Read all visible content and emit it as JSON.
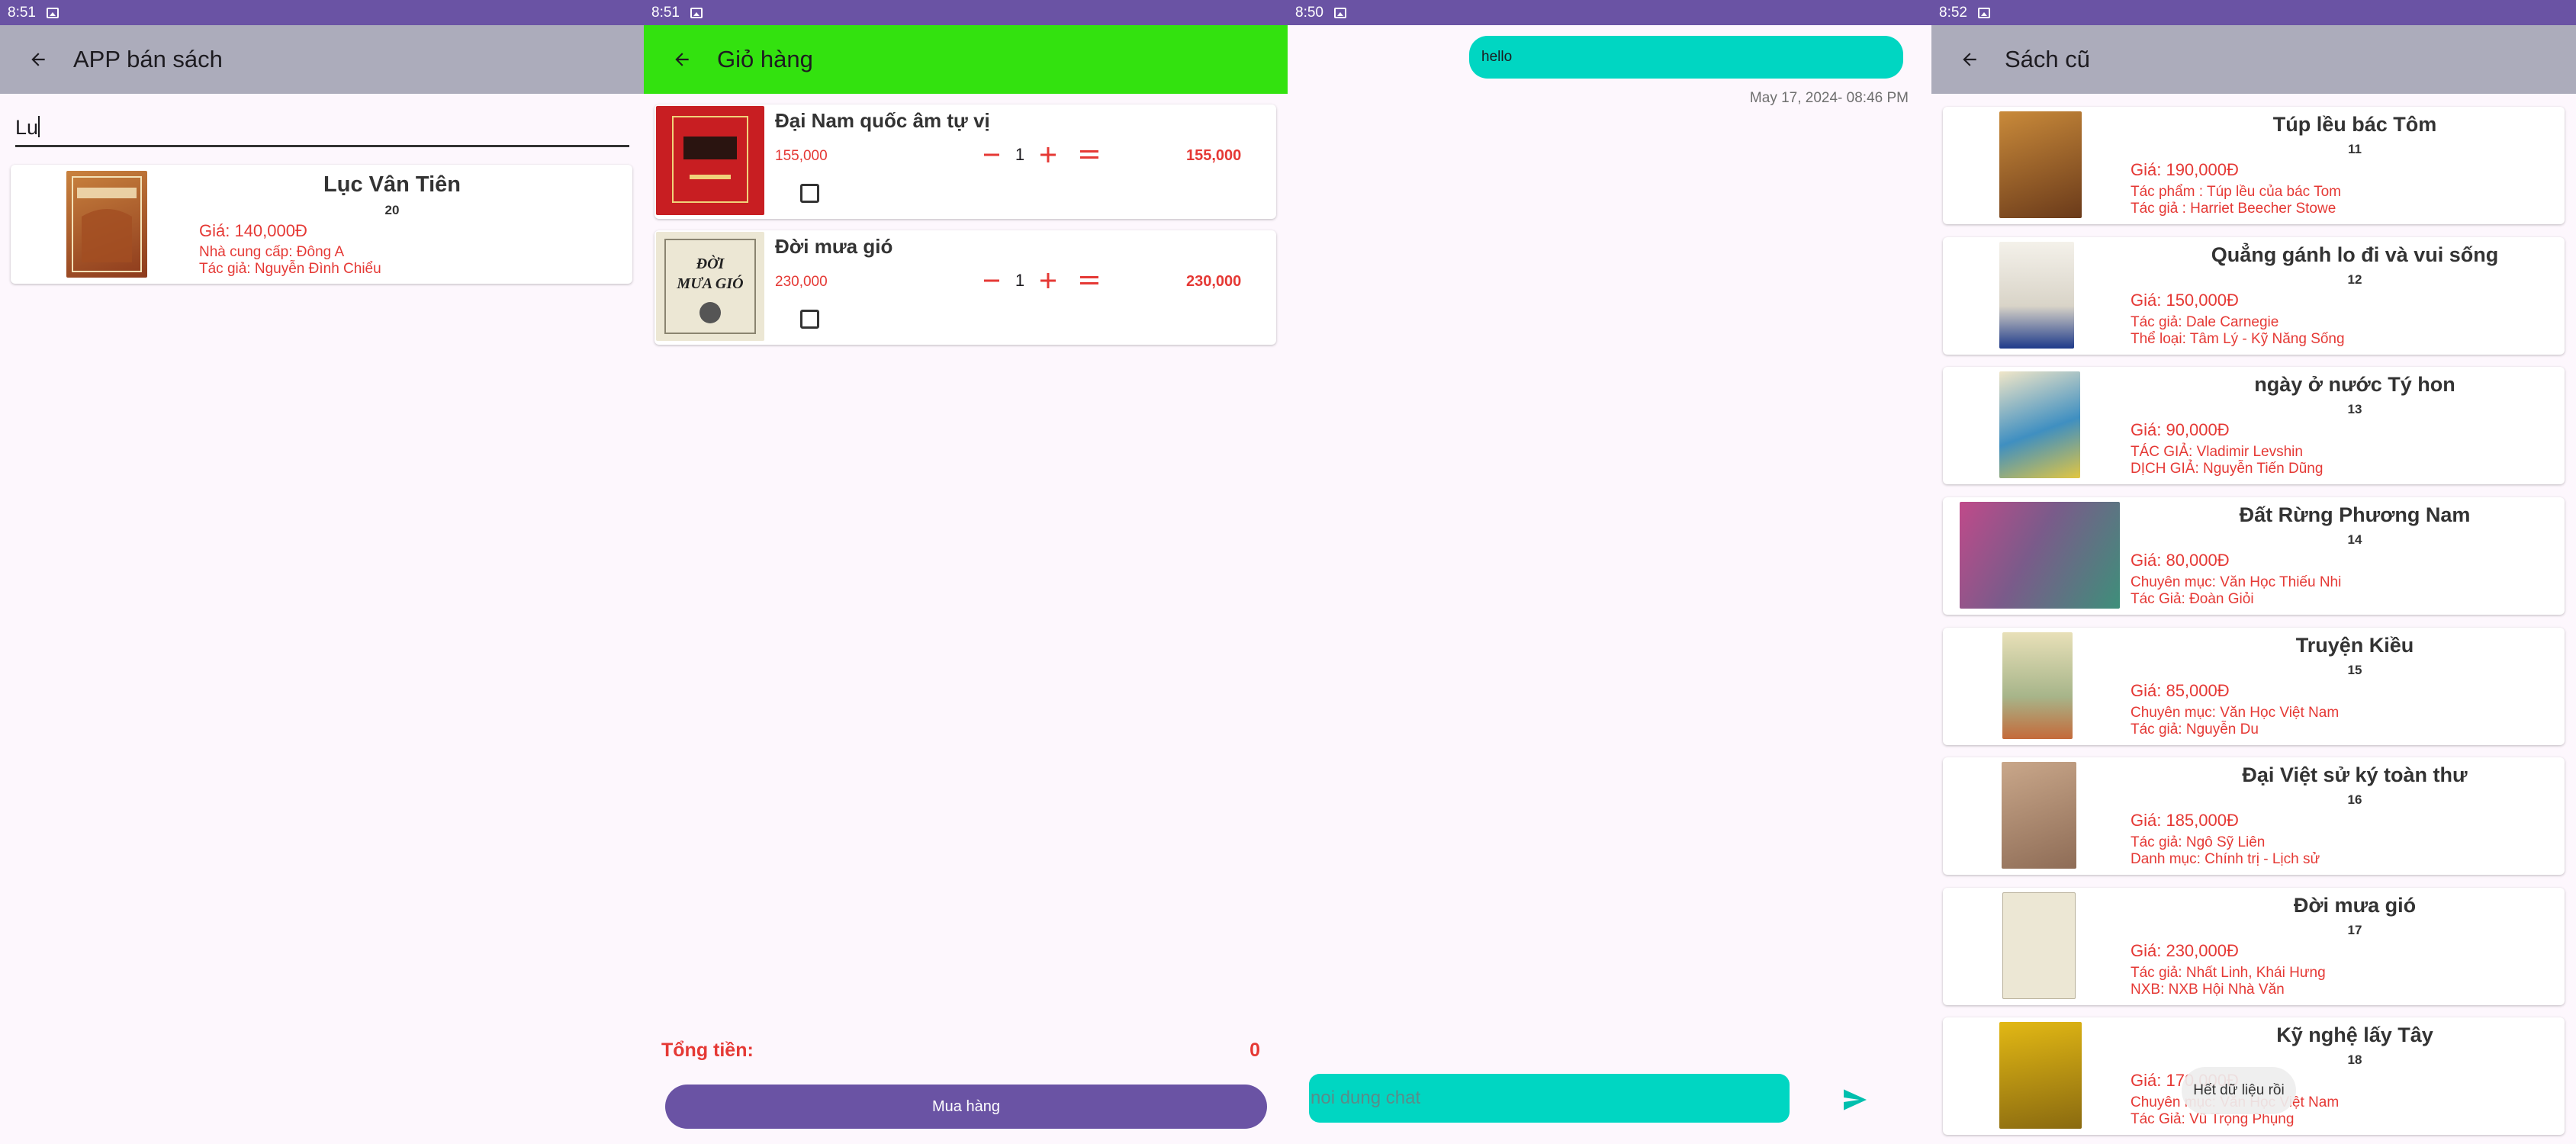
{
  "screens": {
    "search": {
      "time": "8:51",
      "title": "APP bán sách",
      "query": "Lu",
      "result": {
        "title": "Lục Vân Tiên",
        "id": "20",
        "price": "Giá: 140,000Đ",
        "line1": "Nhà cung cấp: Đông A",
        "line2": "Tác giả: Nguyễn Đình Chiểu"
      }
    },
    "cart": {
      "time": "8:51",
      "title": "Giỏ hàng",
      "items": [
        {
          "name": "Đại Nam quốc âm tự vị",
          "price": "155,000",
          "qty": "1",
          "line_total": "155,000"
        },
        {
          "name": "Đời mưa gió",
          "price": "230,000",
          "qty": "1",
          "line_total": "230,000"
        }
      ],
      "total_label": "Tổng tiền:",
      "total_value": "0",
      "buy_label": "Mua hàng"
    },
    "chat": {
      "time": "8:50",
      "message": "hello",
      "timestamp": "May 17, 2024- 08:46 PM",
      "input_placeholder": "noi dung chat"
    },
    "used_books": {
      "time": "8:52",
      "title": "Sách cũ",
      "items": [
        {
          "title": "Túp lều bác Tôm",
          "id": "11",
          "price": "Giá: 190,000Đ",
          "line1": "Tác phẩm : Túp lều của bác Tom",
          "line2": "Tác giả : Harriet Beecher Stowe"
        },
        {
          "title": "Quẳng gánh lo đi và vui sống",
          "id": "12",
          "price": "Giá: 150,000Đ",
          "line1": "Tác giả: Dale Carnegie",
          "line2": "Thể loại: Tâm Lý - Kỹ Năng Sống"
        },
        {
          "title": "ngày ở nước Tý hon",
          "id": "13",
          "price": "Giá: 90,000Đ",
          "line1": "TÁC GIẢ: Vladimir Levshin",
          "line2": "DỊCH GIẢ: Nguyễn Tiến Dũng"
        },
        {
          "title": "Đất Rừng Phương Nam",
          "id": "14",
          "price": "Giá: 80,000Đ",
          "line1": "Chuyên mục: Văn Học Thiếu Nhi",
          "line2": "Tác Giả: Đoàn Giỏi"
        },
        {
          "title": "Truyện Kiều",
          "id": "15",
          "price": "Giá: 85,000Đ",
          "line1": "Chuyên mục: Văn Học Việt Nam",
          "line2": "Tác giả: Nguyễn Du"
        },
        {
          "title": "Đại Việt sử ký toàn thư",
          "id": "16",
          "price": "Giá: 185,000Đ",
          "line1": "Tác giả: Ngô Sỹ Liên",
          "line2": "Danh mục: Chính trị - Lịch sử"
        },
        {
          "title": "Đời mưa gió",
          "id": "17",
          "price": "Giá: 230,000Đ",
          "line1": "Tác giả: Nhất Linh, Khái Hưng",
          "line2": "NXB: NXB Hội Nhà Văn"
        },
        {
          "title": "Kỹ nghệ lấy Tây",
          "id": "18",
          "price": "Giá: 170,000Đ",
          "line1": "Chuyên mục: Văn Học Việt Nam",
          "line2": "Tác Giả: Vũ Trọng Phụng"
        }
      ],
      "toast": "Hết dữ liệu rồi"
    }
  },
  "colors": {
    "status_bar": "#6a53a4",
    "appbar_gray": "#acacbb",
    "appbar_green": "#33e20f",
    "accent_red": "#e53935",
    "chat_teal": "#00d6c2",
    "button_purple": "#6a53a4"
  },
  "icons": [
    "back-arrow-icon",
    "image-notification-icon",
    "minus-icon",
    "plus-icon",
    "equals-icon",
    "checkbox-icon",
    "send-icon"
  ]
}
